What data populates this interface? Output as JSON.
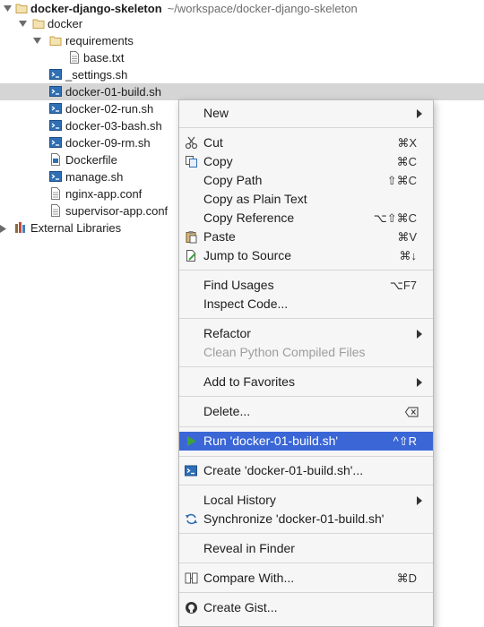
{
  "tree": {
    "project_name": "docker-django-skeleton",
    "project_path": "~/workspace/docker-django-skeleton",
    "docker_folder": "docker",
    "requirements_folder": "requirements",
    "base_txt": "base.txt",
    "settings_sh": "_settings.sh",
    "build_sh": "docker-01-build.sh",
    "run_sh": "docker-02-run.sh",
    "bash_sh": "docker-03-bash.sh",
    "rm_sh": "docker-09-rm.sh",
    "dockerfile": "Dockerfile",
    "manage_sh": "manage.sh",
    "nginx_conf": "nginx-app.conf",
    "supervisor_conf": "supervisor-app.conf",
    "external_libraries": "External Libraries"
  },
  "menu": {
    "new": "New",
    "cut": "Cut",
    "cut_key": "⌘X",
    "copy": "Copy",
    "copy_key": "⌘C",
    "copy_path": "Copy Path",
    "copy_path_key": "⇧⌘C",
    "copy_plain": "Copy as Plain Text",
    "copy_reference": "Copy Reference",
    "copy_reference_key": "⌥⇧⌘C",
    "paste": "Paste",
    "paste_key": "⌘V",
    "jump": "Jump to Source",
    "jump_key": "⌘↓",
    "find_usages": "Find Usages",
    "find_usages_key": "⌥F7",
    "inspect": "Inspect Code...",
    "refactor": "Refactor",
    "clean": "Clean Python Compiled Files",
    "favorites": "Add to Favorites",
    "delete": "Delete...",
    "run": "Run 'docker-01-build.sh'",
    "run_key": "^⇧R",
    "create": "Create 'docker-01-build.sh'...",
    "local_history": "Local History",
    "synchronize": "Synchronize 'docker-01-build.sh'",
    "reveal": "Reveal in Finder",
    "compare": "Compare With...",
    "compare_key": "⌘D",
    "gist": "Create Gist..."
  },
  "colors": {
    "selection": "#d5d5d5",
    "menu_highlight": "#3a66d6",
    "folder": "#c9a24a",
    "script_icon": "#2f6fb5",
    "run_green": "#3ca33c"
  }
}
